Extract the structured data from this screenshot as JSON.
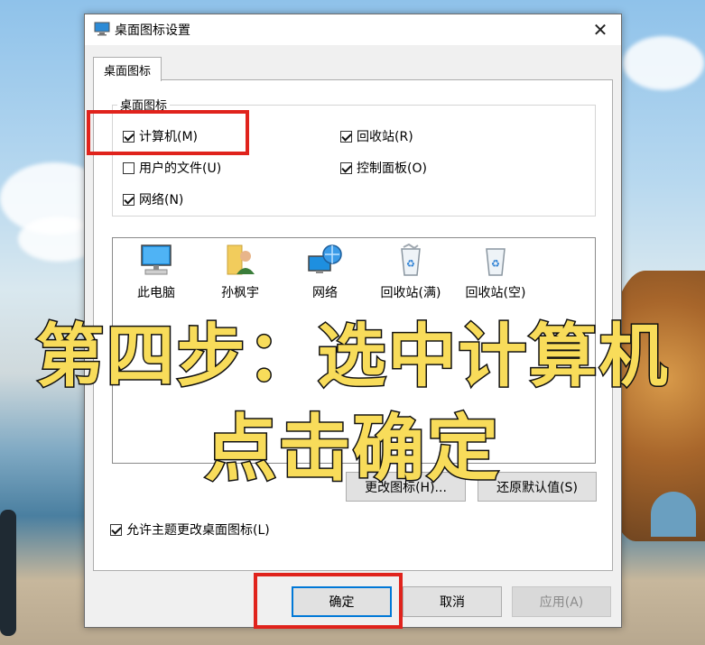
{
  "window": {
    "title": "桌面图标设置",
    "close_glyph": "✕"
  },
  "tab": {
    "label": "桌面图标"
  },
  "group": {
    "label": "桌面图标",
    "checkboxes": [
      {
        "label": "计算机(M)",
        "checked": true
      },
      {
        "label": "回收站(R)",
        "checked": true
      },
      {
        "label": "用户的文件(U)",
        "checked": false
      },
      {
        "label": "控制面板(O)",
        "checked": true
      },
      {
        "label": "网络(N)",
        "checked": true
      }
    ]
  },
  "icons": [
    {
      "label": "此电脑",
      "icon": "computer-icon"
    },
    {
      "label": "孙枫宇",
      "icon": "user-folder-icon"
    },
    {
      "label": "网络",
      "icon": "network-icon"
    },
    {
      "label": "回收站(满)",
      "icon": "recycle-bin-full-icon"
    },
    {
      "label": "回收站(空)",
      "icon": "recycle-bin-empty-icon"
    }
  ],
  "buttons": {
    "change_icon": "更改图标(H)...",
    "restore_default": "还原默认值(S)",
    "ok": "确定",
    "cancel": "取消",
    "apply": "应用(A)"
  },
  "allow_themes": {
    "label": "允许主题更改桌面图标(L)",
    "checked": true
  },
  "overlay": {
    "line1": "第四步：选中计算机",
    "line2": "点击确定"
  },
  "colors": {
    "highlight": "#e0231c",
    "overlay_text": "#f8dc5a",
    "accent": "#0078d7"
  }
}
